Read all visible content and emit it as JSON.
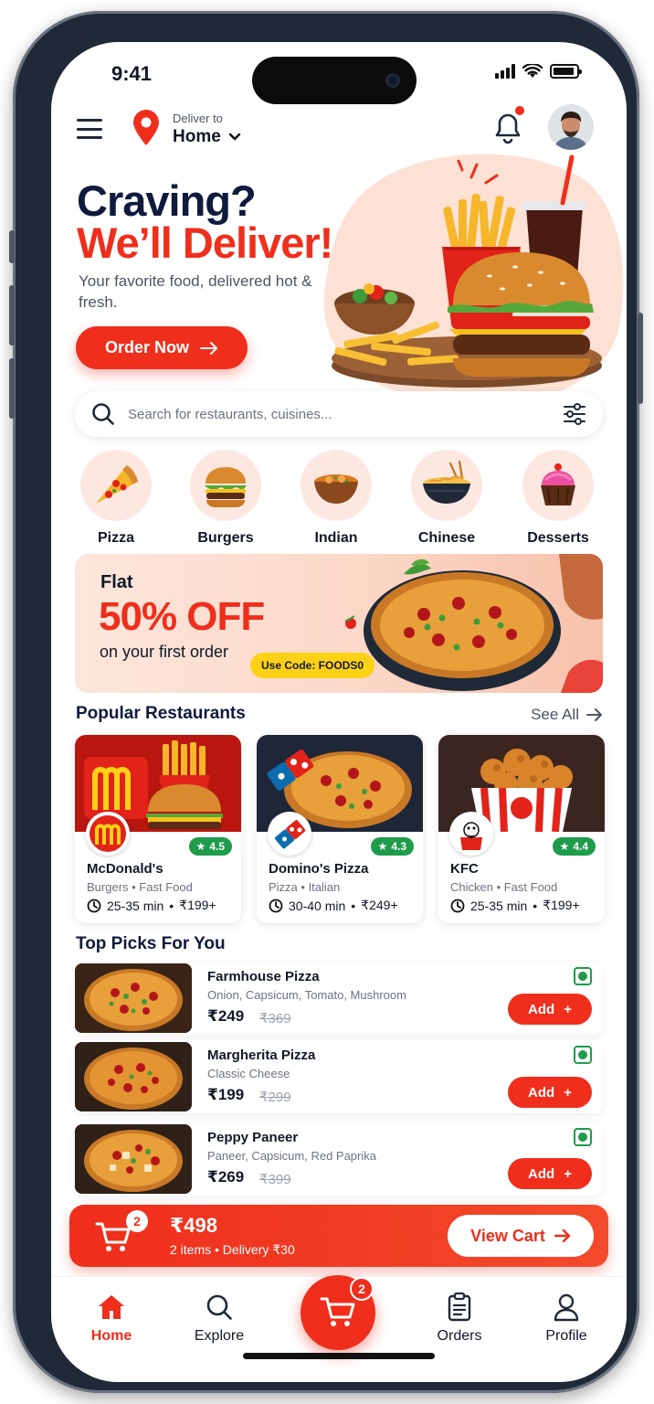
{
  "status": {
    "time": "9:41"
  },
  "header": {
    "deliver_label": "Deliver to",
    "location": "Home",
    "icons": [
      "menu-icon",
      "location-pin-icon",
      "chevron-down-icon",
      "bell-icon",
      "avatar"
    ]
  },
  "hero": {
    "title_line1": "Craving?",
    "title_line2": "We’ll Deliver!",
    "subtitle": "Your favorite food, delivered hot & fresh.",
    "cta": "Order Now"
  },
  "search": {
    "placeholder": "Search for restaurants, cuisines..."
  },
  "categories": [
    {
      "label": "Pizza",
      "icon": "pizza-icon"
    },
    {
      "label": "Burgers",
      "icon": "burger-icon"
    },
    {
      "label": "Indian",
      "icon": "curry-icon"
    },
    {
      "label": "Chinese",
      "icon": "noodles-icon"
    },
    {
      "label": "Desserts",
      "icon": "cupcake-icon"
    }
  ],
  "promo": {
    "flat": "Flat",
    "headline": "50% OFF",
    "subtitle": "on your first order",
    "code": "Use Code: FOODS0"
  },
  "popular": {
    "title": "Popular Restaurants",
    "see_all": "See All",
    "items": [
      {
        "name": "McDonald's",
        "rating": "4.5",
        "cuisine": "Burgers • Fast Food",
        "time": "25-35 min",
        "price": "₹199+"
      },
      {
        "name": "Domino's Pizza",
        "rating": "4.3",
        "cuisine": "Pizza • Italian",
        "time": "30-40 min",
        "price": "₹249+"
      },
      {
        "name": "KFC",
        "rating": "4.4",
        "cuisine": "Chicken • Fast Food",
        "time": "25-35 min",
        "price": "₹199+"
      }
    ]
  },
  "picks": {
    "title": "Top Picks For You",
    "add_label": "Add",
    "items": [
      {
        "name": "Farmhouse Pizza",
        "desc": "Onion, Capsicum, Tomato, Mushroom",
        "price": "₹249",
        "old_price": "₹369"
      },
      {
        "name": "Margherita Pizza",
        "desc": "Classic Cheese",
        "price": "₹199",
        "old_price": "₹299"
      },
      {
        "name": "Peppy Paneer",
        "desc": "Paneer, Capsicum, Red Paprika",
        "price": "₹269",
        "old_price": "₹399"
      }
    ]
  },
  "cart": {
    "count": "2",
    "total": "₹498",
    "summary": "2 items • Delivery ₹30",
    "cta": "View Cart"
  },
  "nav": {
    "home": "Home",
    "explore": "Explore",
    "cart_badge": "2",
    "orders": "Orders",
    "profile": "Profile"
  },
  "colors": {
    "accent": "#ef2e1c",
    "navy": "#0f1b3d",
    "rating": "#1e9b4b",
    "promo_code": "#fcd116"
  }
}
